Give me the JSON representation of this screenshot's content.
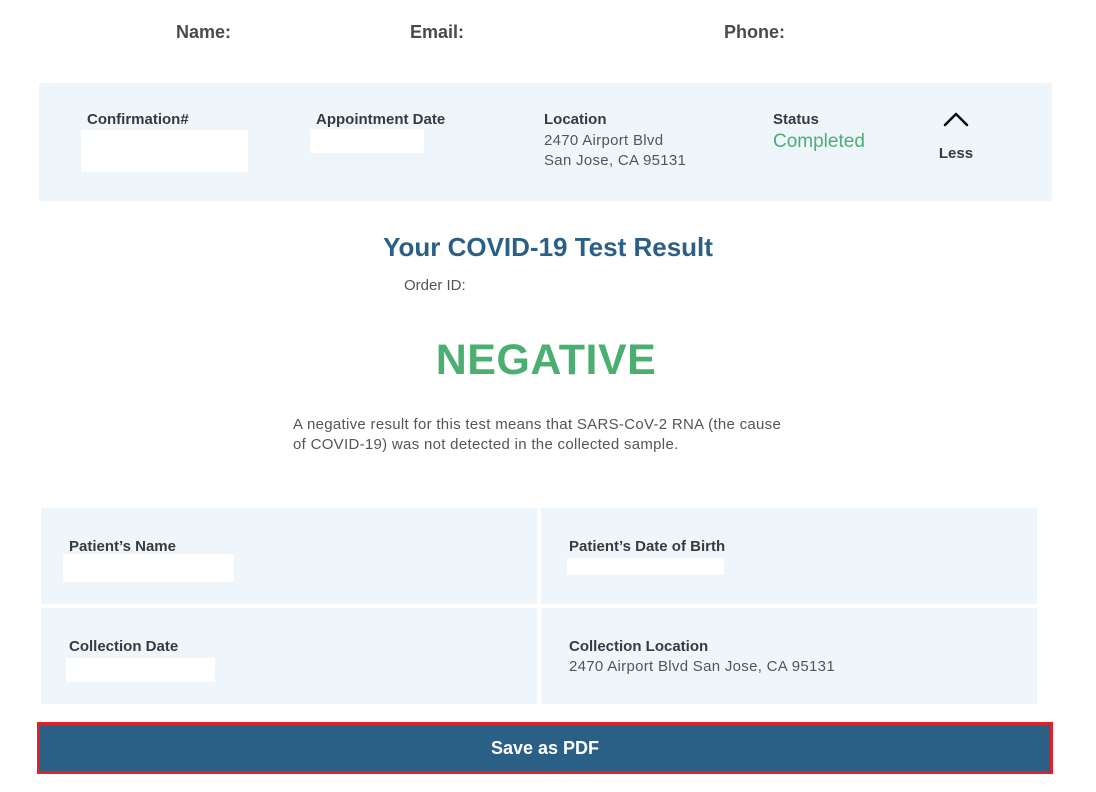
{
  "contact": {
    "name_label": "Name:",
    "email_label": "Email:",
    "phone_label": "Phone:"
  },
  "appointment": {
    "confirmation_label": "Confirmation#",
    "date_label": "Appointment Date",
    "location_label": "Location",
    "location_line1": "2470 Airport Blvd",
    "location_line2": "San Jose, CA 95131",
    "status_label": "Status",
    "status_value": "Completed",
    "toggle_label": "Less",
    "toggle_icon": "chevron-up-icon"
  },
  "result": {
    "title": "Your COVID-19 Test Result",
    "order_id_label": "Order ID:",
    "value": "NEGATIVE",
    "description_line1": "A negative result for this test means that SARS-CoV-2 RNA (the cause",
    "description_line2": "of COVID-19) was not detected in the collected sample."
  },
  "patient": {
    "name_label": "Patient’s Name",
    "dob_label": "Patient’s Date of Birth",
    "collection_date_label": "Collection Date",
    "collection_location_label": "Collection Location",
    "collection_location_value": "2470 Airport Blvd San Jose, CA 95131"
  },
  "actions": {
    "save_pdf_label": "Save as PDF"
  },
  "colors": {
    "accent_blue": "#2a5f86",
    "success_green": "#4caf72",
    "panel_bg": "#eef6fc",
    "highlight_border": "#e0202a"
  }
}
